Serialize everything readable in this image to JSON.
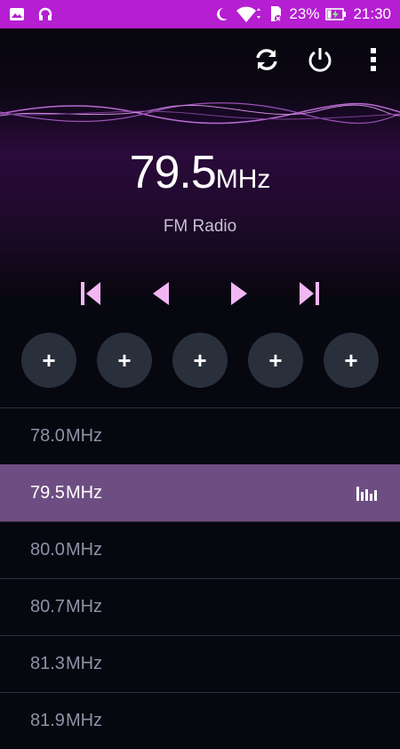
{
  "status_bar": {
    "battery_percent": "23%",
    "time": "21:30",
    "icons": [
      "image-icon",
      "headset-icon",
      "moon-icon",
      "wifi-icon",
      "sd-card-icon",
      "battery-charging-icon"
    ]
  },
  "toolbar": {
    "icons": [
      "refresh-icon",
      "power-icon",
      "more-vert-icon"
    ]
  },
  "current": {
    "frequency": "79.5",
    "unit": "MHz",
    "band": "FM Radio"
  },
  "transport": {
    "icons": [
      "skip-previous-icon",
      "seek-back-icon",
      "seek-forward-icon",
      "skip-next-icon"
    ]
  },
  "presets": [
    {
      "label": "+"
    },
    {
      "label": "+"
    },
    {
      "label": "+"
    },
    {
      "label": "+"
    },
    {
      "label": "+"
    }
  ],
  "stations": [
    {
      "freq": "78.0",
      "unit": "MHz"
    },
    {
      "freq": "79.5",
      "unit": "MHz"
    },
    {
      "freq": "80.0",
      "unit": "MHz"
    },
    {
      "freq": "80.7",
      "unit": "MHz"
    },
    {
      "freq": "81.3",
      "unit": "MHz"
    },
    {
      "freq": "81.9",
      "unit": "MHz"
    }
  ],
  "active_station_index": 1,
  "colors": {
    "status_bar": "#b51ed1",
    "accent": "#f3b6f5",
    "active_row": "#6e4e82",
    "preset_bg": "#2a2f3c"
  }
}
